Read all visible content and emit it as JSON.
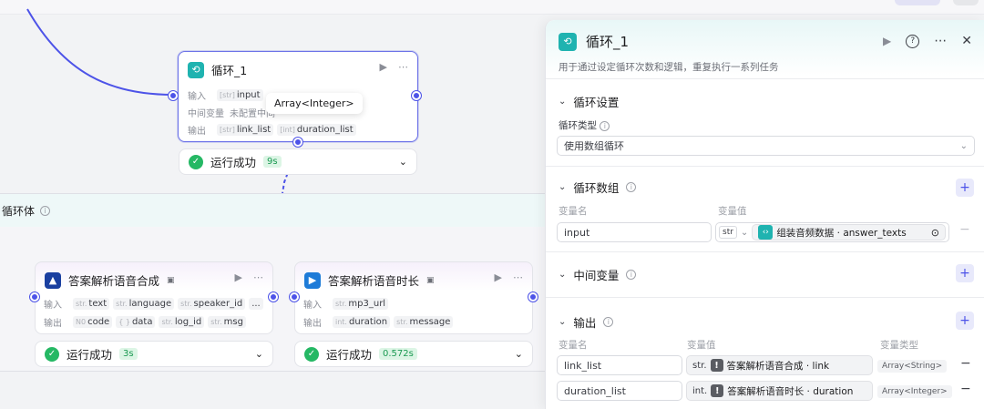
{
  "loop_node": {
    "title": "循环_1",
    "input_label": "输入",
    "input_tag": "input",
    "mid_label": "中间变量",
    "mid_value": "未配置中间",
    "output_label": "输出",
    "out_tag1": "link_list",
    "out_tag2": "duration_list",
    "tooltip": "Array<Integer>",
    "status": "运行成功",
    "duration": "9s"
  },
  "loop_body": {
    "label": "循环体"
  },
  "tts_node": {
    "title": "答案解析语音合成",
    "input_label": "输入",
    "inputs": [
      {
        "t": "str.",
        "n": "text"
      },
      {
        "t": "str.",
        "n": "language"
      },
      {
        "t": "str.",
        "n": "speaker_id"
      }
    ],
    "inputs_more": "...",
    "output_label": "输出",
    "outputs": [
      {
        "t": "N0",
        "n": "code"
      },
      {
        "t": "{ }",
        "n": "data"
      },
      {
        "t": "str.",
        "n": "log_id"
      },
      {
        "t": "str.",
        "n": "msg"
      }
    ],
    "status": "运行成功",
    "duration": "3s"
  },
  "len_node": {
    "title": "答案解析语音时长",
    "input_label": "输入",
    "inputs": [
      {
        "t": "str.",
        "n": "mp3_url"
      }
    ],
    "output_label": "输出",
    "outputs": [
      {
        "t": "int.",
        "n": "duration"
      },
      {
        "t": "str.",
        "n": "message"
      }
    ],
    "status": "运行成功",
    "duration": "0.572s"
  },
  "panel": {
    "title": "循环_1",
    "desc": "用于通过设定循环次数和逻辑，重复执行一系列任务",
    "sec_settings": "循环设置",
    "loop_type_label": "循环类型",
    "loop_type_value": "使用数组循环",
    "sec_array": "循环数组",
    "var_name_hdr": "变量名",
    "var_val_hdr": "变量值",
    "array_var_name": "input",
    "array_type": "str",
    "array_ref": "组装音频数据 · answer_texts",
    "sec_mid": "中间变量",
    "sec_output": "输出",
    "var_type_hdr": "变量类型",
    "outputs": [
      {
        "name": "link_list",
        "type_prefix": "str.",
        "ref": "答案解析语音合成 · link",
        "vtype": "Array<String>"
      },
      {
        "name": "duration_list",
        "type_prefix": "int.",
        "ref": "答案解析语音时长 · duration",
        "vtype": "Array<Integer>"
      }
    ]
  },
  "colors": {
    "accent": "#4d53e8",
    "teal": "#1fb3b0",
    "success": "#25b864"
  }
}
